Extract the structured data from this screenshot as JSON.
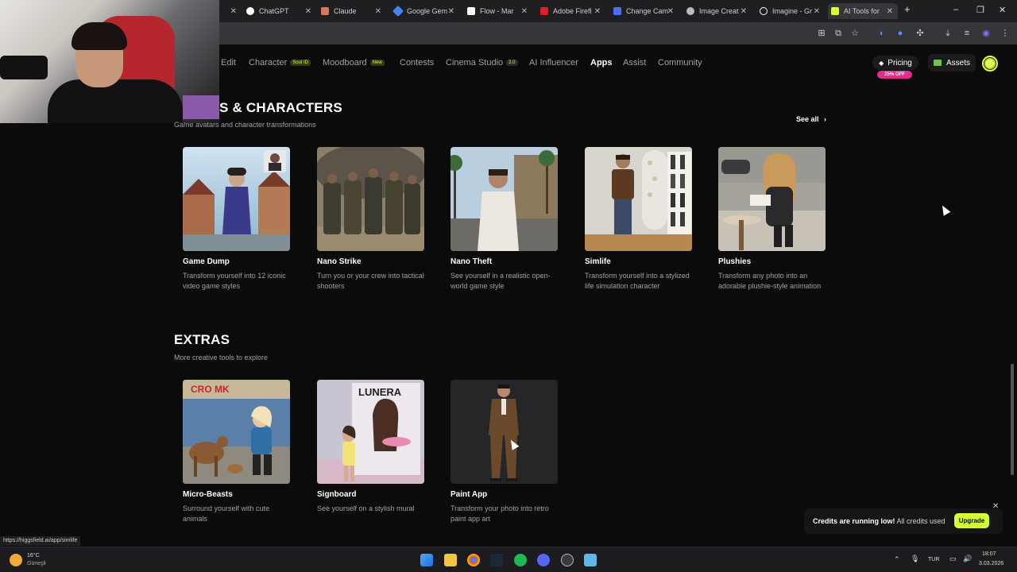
{
  "browser": {
    "tabs": [
      {
        "label": "ChatGPT",
        "color": "#ffffff"
      },
      {
        "label": "Claude",
        "color": "#d97757"
      },
      {
        "label": "Google Gem",
        "color": "#4285f4"
      },
      {
        "label": "Flow - Mar",
        "color": "#ffffff"
      },
      {
        "label": "Adobe Firefl",
        "color": "#e01e25"
      },
      {
        "label": "Change Cam",
        "color": "#4c6ef5"
      },
      {
        "label": "Image Creat",
        "color": "#bbbbbb"
      },
      {
        "label": "Imagine - Gr",
        "color": "#ffffff"
      },
      {
        "label": "AI Tools for",
        "color": "#d6ff3a"
      }
    ]
  },
  "nav": {
    "items": [
      "Edit",
      "Character",
      "Moodboard",
      "Contests",
      "Cinema Studio",
      "AI Influencer",
      "Apps",
      "Assist",
      "Community"
    ],
    "badge_soul": "Soul ID",
    "badge_new": "New",
    "badge_version": "2.0",
    "pricing": "Pricing",
    "pricing_badge": "25% OFF",
    "assets": "Assets"
  },
  "section_games": {
    "title": "S & CHARACTERS",
    "subtitle": "Game avatars and character transformations",
    "see_all": "See all",
    "cards": [
      {
        "title": "Game Dump",
        "desc": "Transform yourself into 12 iconic video game styles"
      },
      {
        "title": "Nano Strike",
        "desc": "Turn you or your crew into tactical shooters"
      },
      {
        "title": "Nano Theft",
        "desc": "See yourself in a realistic open-world game style"
      },
      {
        "title": "Simlife",
        "desc": "Transform yourself into a stylized life simulation character"
      },
      {
        "title": "Plushies",
        "desc": "Transform any photo into an adorable plushie-style animation"
      }
    ]
  },
  "section_extras": {
    "title": "EXTRAS",
    "subtitle": "More creative tools to explore",
    "cards": [
      {
        "title": "Micro-Beasts",
        "desc": "Surround yourself with cute animals"
      },
      {
        "title": "Signboard",
        "desc": "See yourself on a stylish mural"
      },
      {
        "title": "Paint App",
        "desc": "Transform your photo into retro paint app art"
      }
    ]
  },
  "thumbnails": {
    "signboard_text": "LUNERA",
    "microbeasts_text": "CRO MK"
  },
  "toast": {
    "bold": "Credits are running low!",
    "rest": "All credits used",
    "button": "Upgrade"
  },
  "status_url": "https://higgsfield.ai/app/simlife",
  "taskbar": {
    "temp": "16°C",
    "weather": "Güneşli",
    "lang": "TUR",
    "time": "18:07",
    "date": "3.03.2026"
  }
}
